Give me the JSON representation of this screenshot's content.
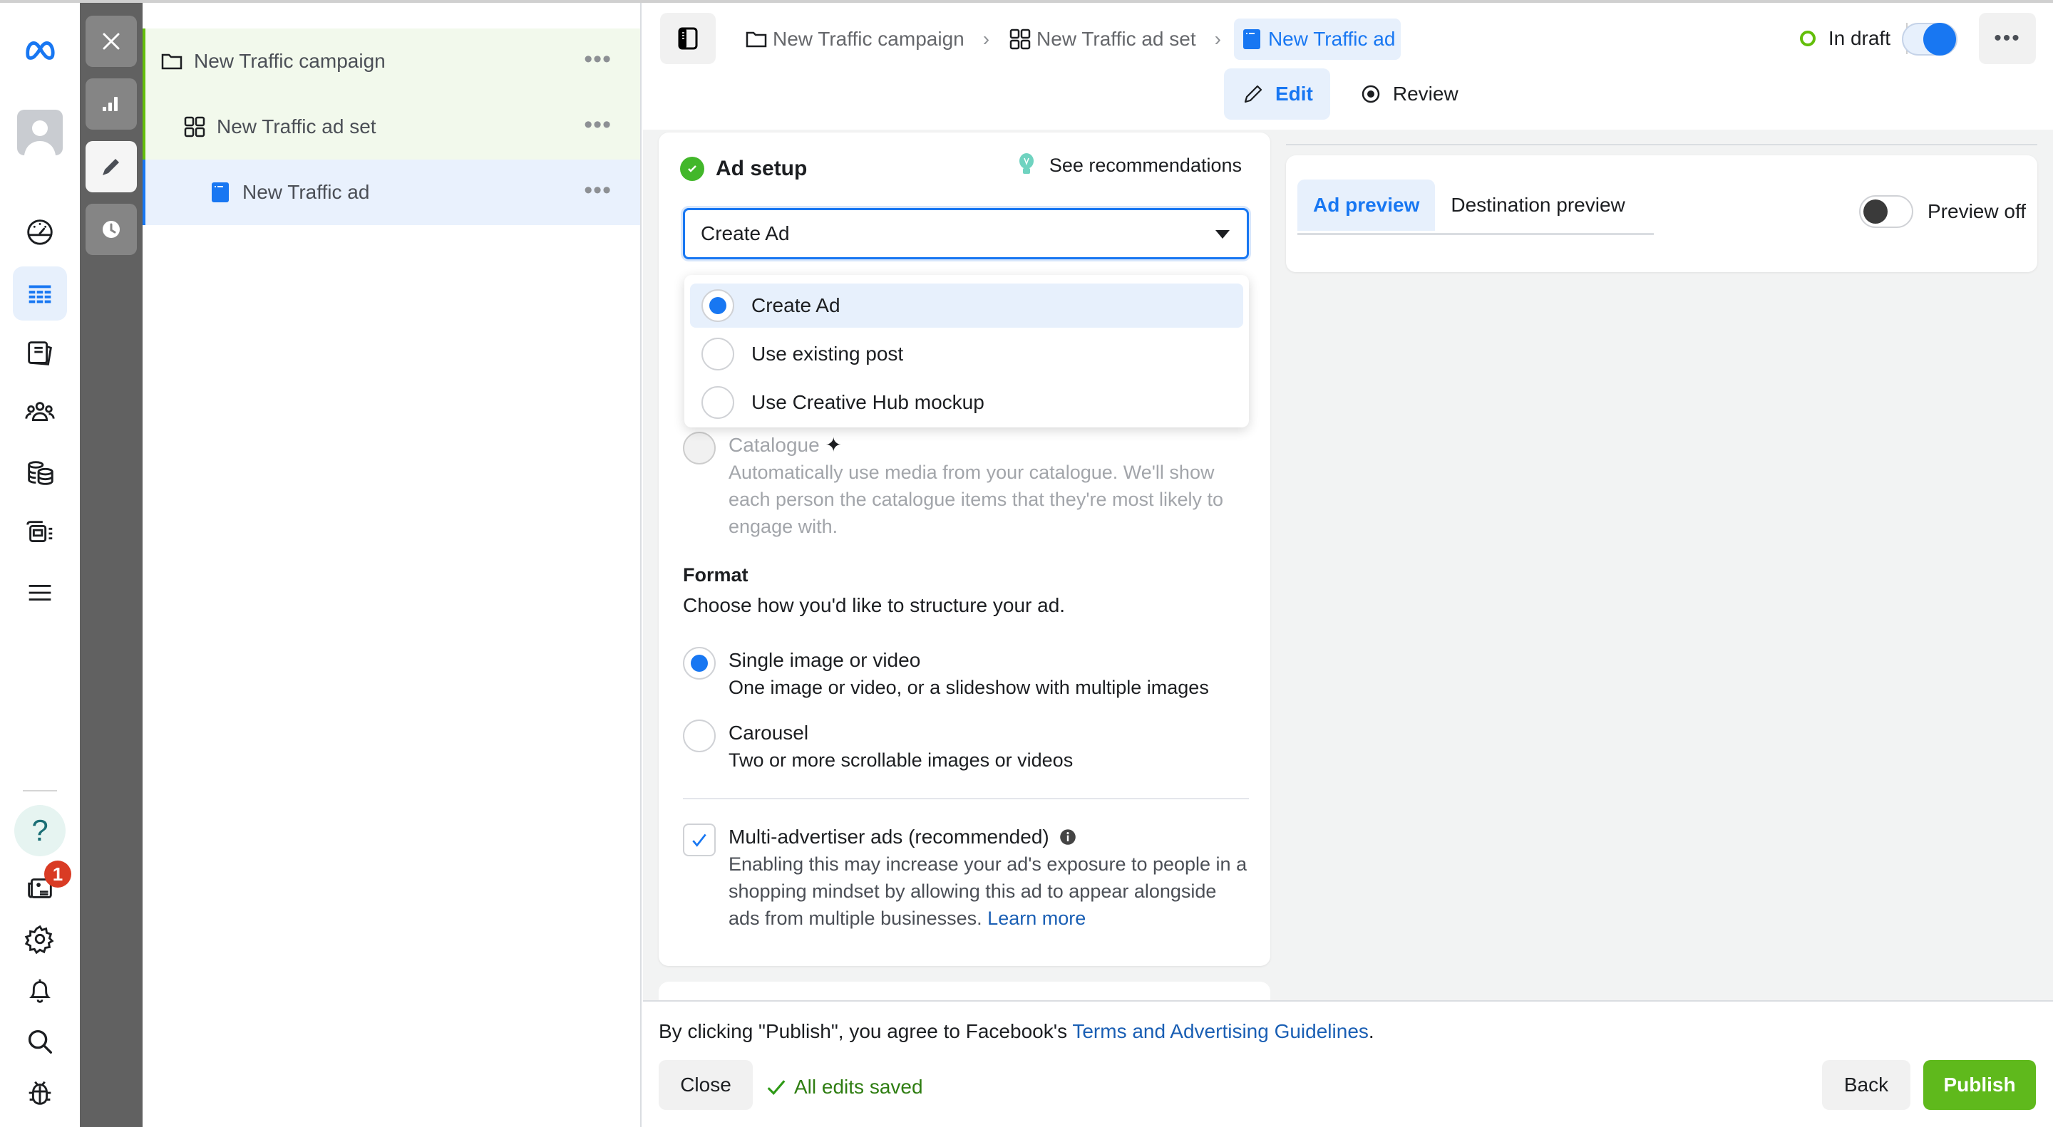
{
  "tool_strip": {
    "close_label": "Close panel",
    "items": [
      "reporting",
      "edit",
      "history"
    ]
  },
  "rail": {
    "notification_badge": "1",
    "help_label": "?"
  },
  "tree": {
    "items": [
      {
        "label": "New Traffic campaign",
        "type": "campaign",
        "more": "•••"
      },
      {
        "label": "New Traffic ad set",
        "type": "ad-set",
        "more": "•••"
      },
      {
        "label": "New Traffic ad",
        "type": "ad",
        "more": "•••"
      }
    ]
  },
  "header": {
    "breadcrumbs": [
      {
        "label": "New Traffic campaign"
      },
      {
        "label": "New Traffic ad set"
      },
      {
        "label": "New Traffic ad"
      }
    ],
    "separator": "›",
    "status": "In draft",
    "toggle_on": true,
    "more": "•••",
    "modes": {
      "edit": "Edit",
      "review": "Review"
    }
  },
  "ad_setup": {
    "title": "Ad setup",
    "recommendations": "See recommendations",
    "select_value": "Create Ad",
    "dropdown_options": [
      {
        "label": "Create Ad",
        "selected": true
      },
      {
        "label": "Use existing post",
        "selected": false
      },
      {
        "label": "Use Creative Hub mockup",
        "selected": false
      }
    ],
    "catalogue": {
      "label": "Catalogue",
      "description": "Automatically use media from your catalogue. We'll show each person the catalogue items that they're most likely to engage with."
    },
    "format": {
      "heading": "Format",
      "subheading": "Choose how you'd like to structure your ad.",
      "options": [
        {
          "label": "Single image or video",
          "description": "One image or video, or a slideshow with multiple images",
          "selected": true
        },
        {
          "label": "Carousel",
          "description": "Two or more scrollable images or videos",
          "selected": false
        }
      ]
    },
    "multi_advertiser": {
      "label": "Multi-advertiser ads (recommended)",
      "checked": true,
      "description": "Enabling this may increase your ad's exposure to people in a shopping mindset by allowing this ad to appear alongside ads from multiple businesses.",
      "link": "Learn more"
    }
  },
  "preview": {
    "tabs": [
      "Ad preview",
      "Destination preview"
    ],
    "active_tab": "Ad preview",
    "toggle_label": "Preview off",
    "toggle_on": false
  },
  "footer": {
    "agree_prefix": "By clicking \"Publish\", you agree to Facebook's ",
    "agree_link": "Terms and Advertising Guidelines",
    "agree_suffix": ".",
    "close": "Close",
    "saved": "All edits saved",
    "back": "Back",
    "publish": "Publish"
  },
  "colors": {
    "accent": "#1877f2",
    "publish_green": "#5fb91c",
    "campaign_bar": "#63be0a",
    "badge_red": "#d93b24"
  }
}
